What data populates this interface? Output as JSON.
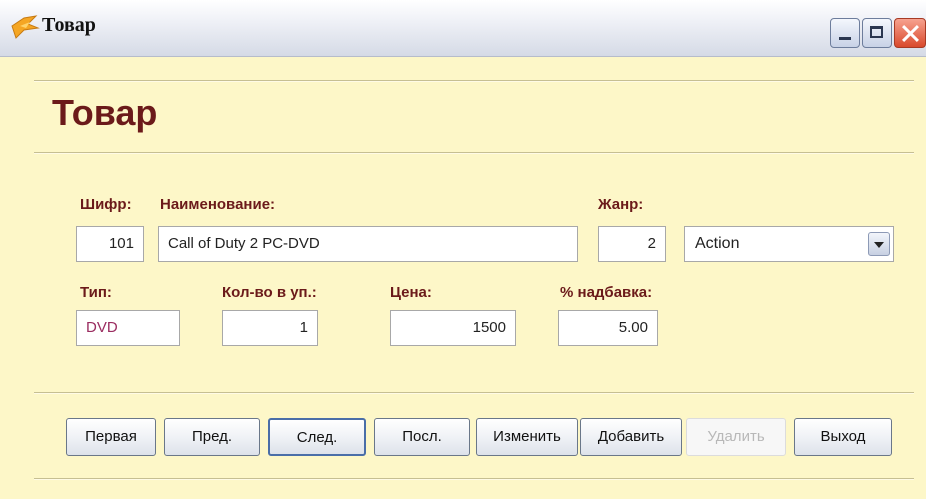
{
  "window": {
    "title": "Товар"
  },
  "form": {
    "heading": "Товар",
    "fields": {
      "code": {
        "label": "Шифр:",
        "value": "101"
      },
      "name": {
        "label": "Наименование:",
        "value": "Call of Duty 2 PC-DVD"
      },
      "genre": {
        "label": "Жанр:",
        "value": "2",
        "selected": "Action"
      },
      "type": {
        "label": "Тип:",
        "value": "DVD"
      },
      "qty": {
        "label": "Кол-во в уп.:",
        "value": "1"
      },
      "price": {
        "label": "Цена:",
        "value": "1500"
      },
      "markup": {
        "label": "% надбавка:",
        "value": "5.00"
      }
    }
  },
  "buttons": {
    "first": "Первая",
    "prev": "Пред.",
    "next": "След.",
    "last": "Посл.",
    "edit": "Изменить",
    "add": "Добавить",
    "delete": "Удалить",
    "exit": "Выход"
  },
  "colors": {
    "background": "#fdf7c8",
    "label": "#6b1a1a",
    "type_value": "#9a2c60",
    "title_gradient_end": "#d5dae6"
  }
}
